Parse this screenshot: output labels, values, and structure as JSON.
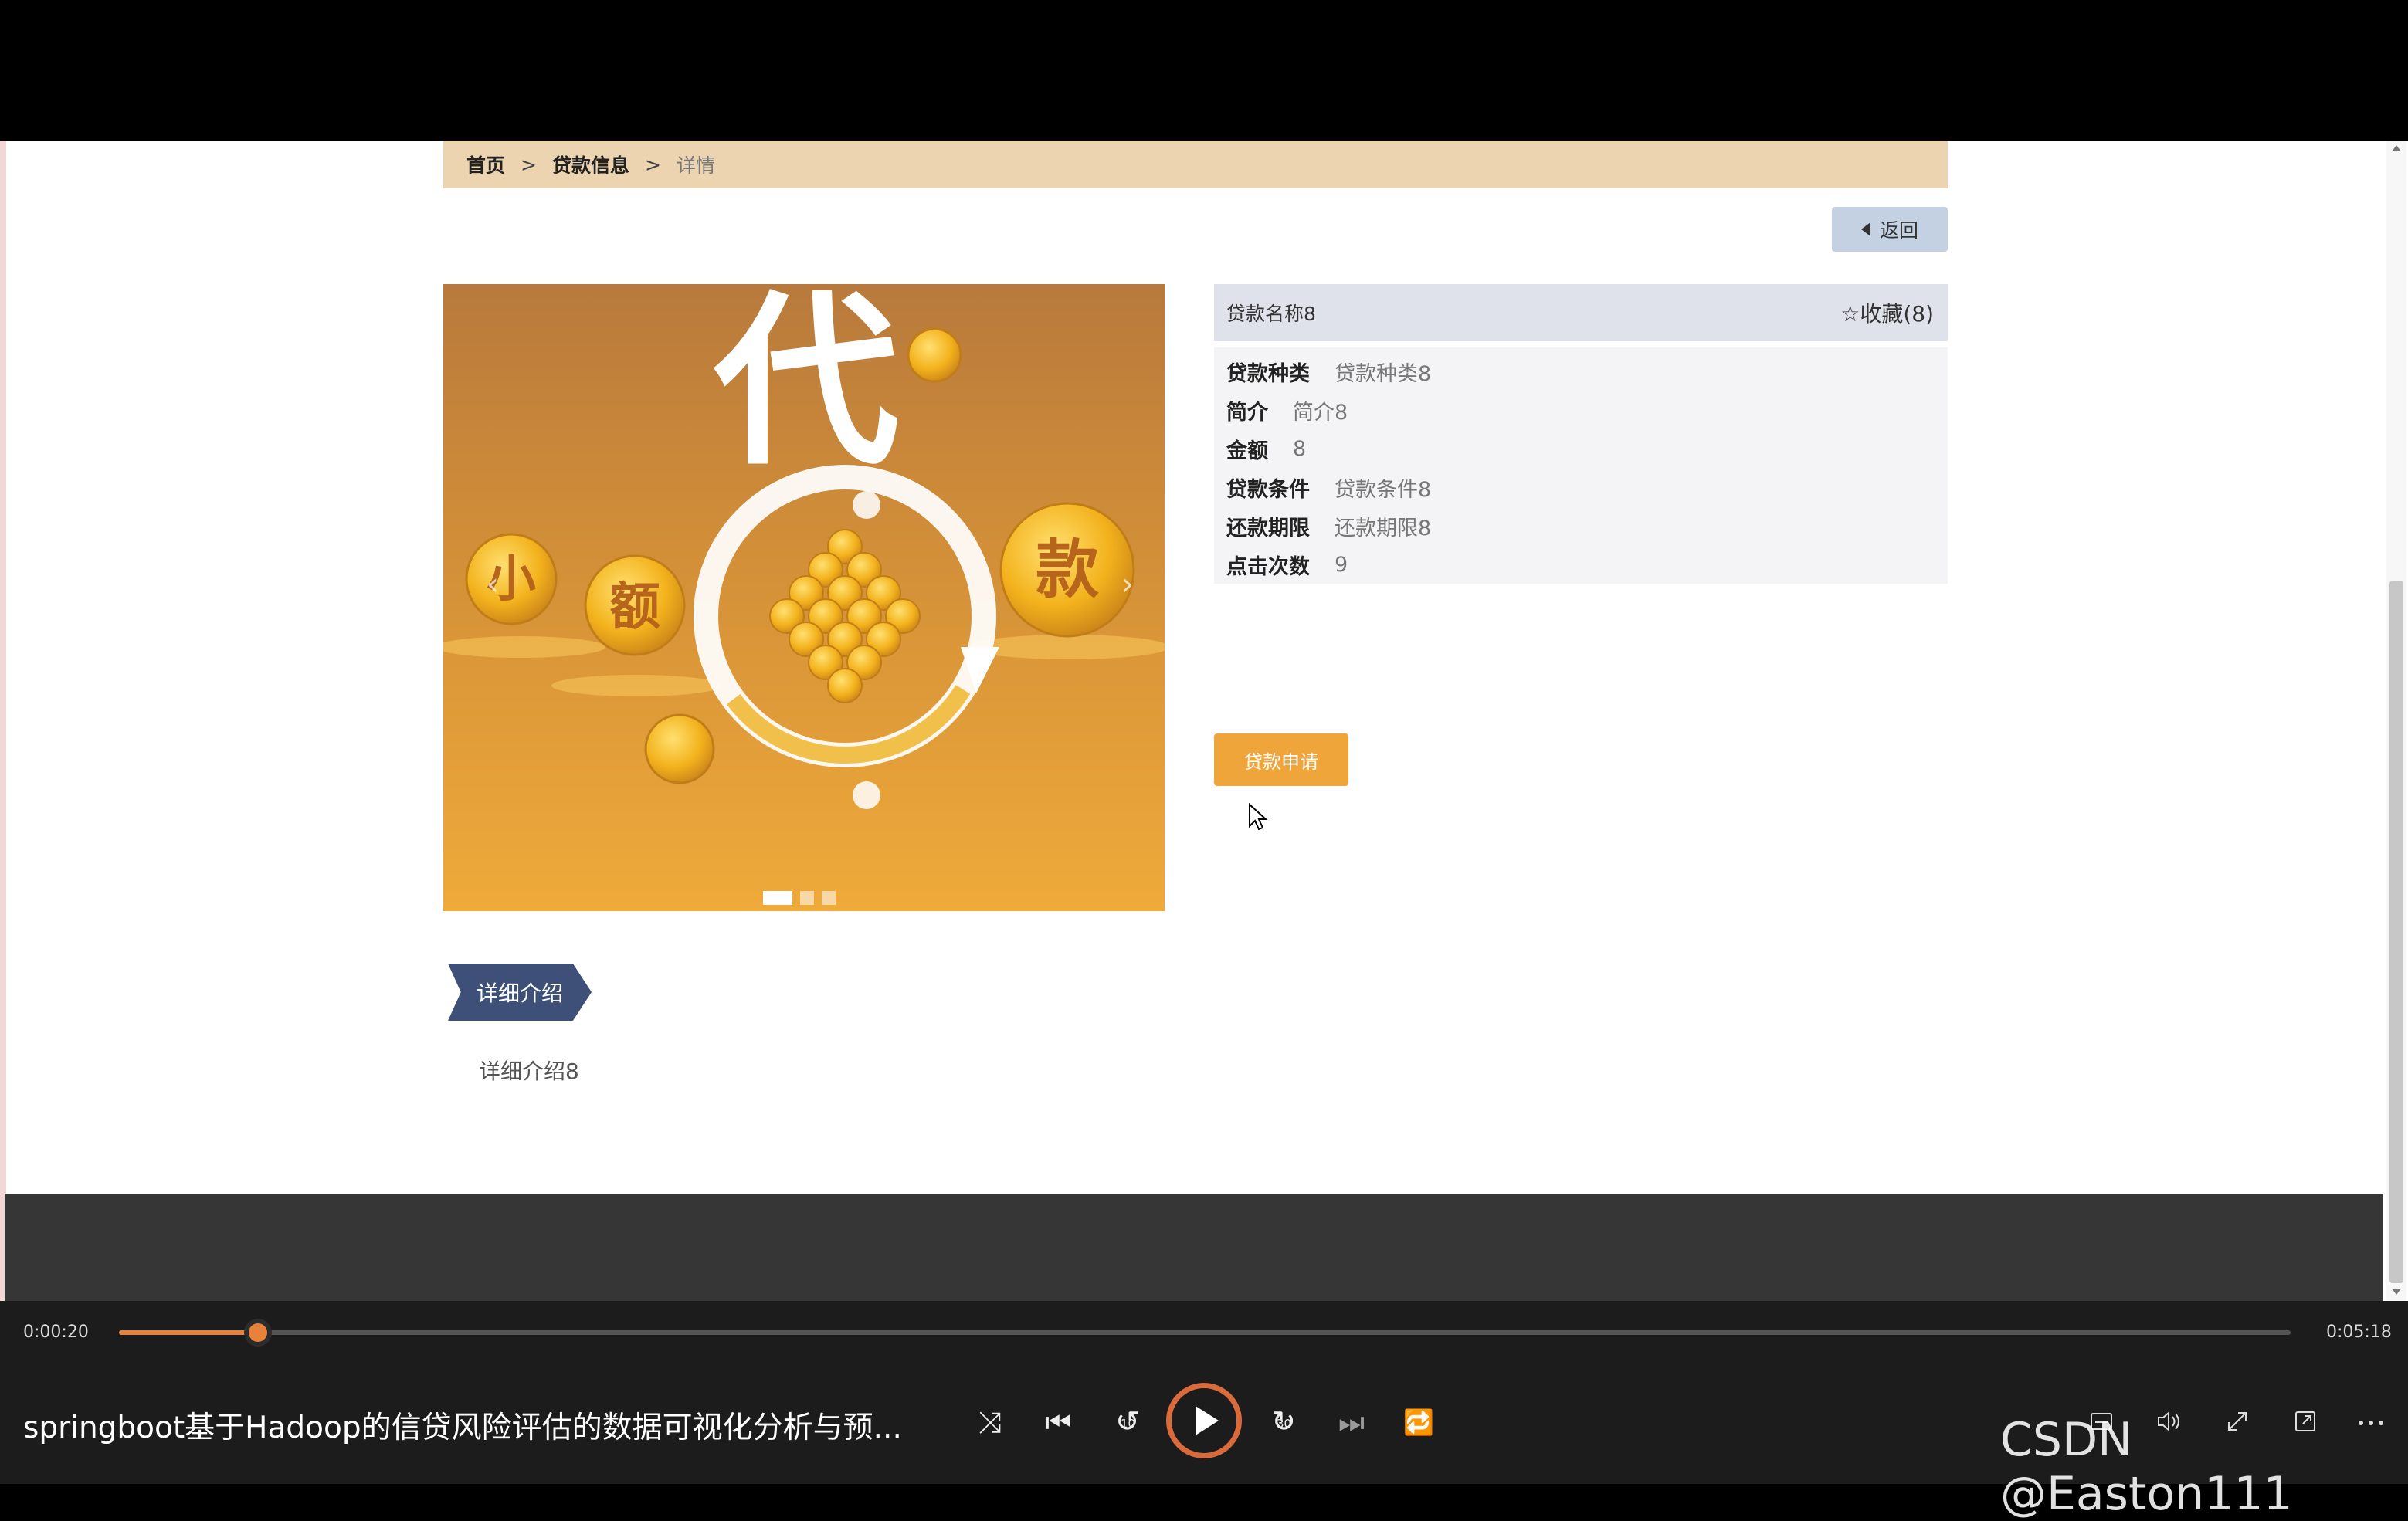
{
  "breadcrumb": {
    "home": "首页",
    "sep1": ">",
    "section": "贷款信息",
    "sep2": ">",
    "current": "详情"
  },
  "back_button": {
    "label": "返回",
    "icon": "caret-left-icon"
  },
  "carousel": {
    "image": {
      "big_character": "代",
      "coin_labels": [
        "小",
        "额",
        "款"
      ],
      "colors": {
        "background_top": "#b87a3c",
        "background_bottom": "#efaa3a",
        "coin": "#f3b21c"
      }
    },
    "arrows": [
      "‹",
      "›"
    ],
    "dots": [
      true,
      false,
      false
    ]
  },
  "product": {
    "name": "贷款名称8",
    "favorite": {
      "icon": "star-outline-icon",
      "label": "收藏(8)"
    },
    "fields": [
      {
        "key": "贷款种类",
        "value": "贷款种类8"
      },
      {
        "key": "简介",
        "value": "简介8"
      },
      {
        "key": "金额",
        "value": "8"
      },
      {
        "key": "贷款条件",
        "value": "贷款条件8"
      },
      {
        "key": "还款期限",
        "value": "还款期限8"
      },
      {
        "key": "点击次数",
        "value": "9"
      }
    ],
    "apply_button": "贷款申请"
  },
  "detail": {
    "tag": "详细介绍",
    "text": "详细介绍8"
  },
  "player": {
    "current_time": "0:00:20",
    "total_time": "0:05:18",
    "progress": 0.064,
    "title": "springboot基于Hadoop的信贷风险评估的数据可视化分析与预...",
    "controls": {
      "shuffle": "⤨",
      "previous": "⏮",
      "rewind_10": "↺",
      "rewind_10_label": "10",
      "forward_30": "↻",
      "forward_30_label": "30",
      "next": "⏭",
      "repeat": "🔁"
    },
    "accent_color": "#e8813a"
  },
  "watermark": "CSDN @Easton111"
}
